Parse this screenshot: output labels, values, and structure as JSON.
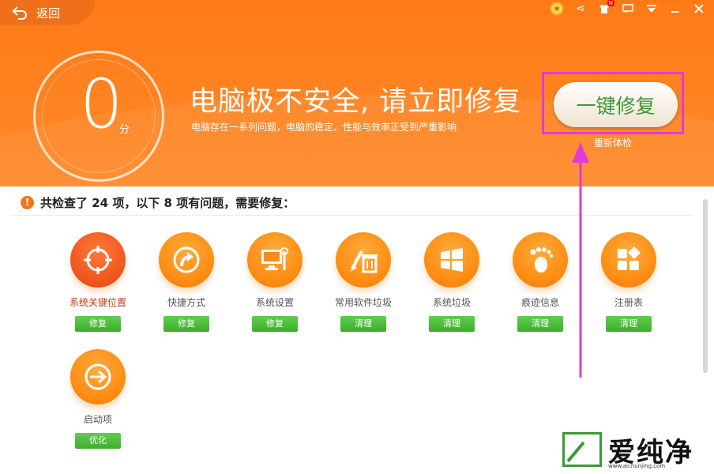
{
  "header": {
    "back_label": "返回",
    "score": "0",
    "score_unit": "分",
    "headline": "电脑极不安全, 请立即修复",
    "subline": "电脑存在一系列问题，电脑的稳定、性能与效率正受到严重影响",
    "fix_button": "一键修复",
    "recheck": "重新体检",
    "top_icons": [
      "medal-icon",
      "share-icon",
      "shirt-icon",
      "message-icon",
      "menu-icon",
      "minimize-icon",
      "close-icon"
    ],
    "badge": "N"
  },
  "panel": {
    "summary": "共检查了 24 项，以下 8 项有问题，需要修复：",
    "items": [
      {
        "label": "系统关键位置",
        "action": "修复",
        "icon": "target-icon"
      },
      {
        "label": "快捷方式",
        "action": "修复",
        "icon": "shortcut-arrow-icon"
      },
      {
        "label": "系统设置",
        "action": "修复",
        "icon": "monitor-wrench-icon"
      },
      {
        "label": "常用软件垃圾",
        "action": "清理",
        "icon": "brush-trash-icon"
      },
      {
        "label": "系统垃圾",
        "action": "清理",
        "icon": "windows-logo-icon"
      },
      {
        "label": "痕迹信息",
        "action": "清理",
        "icon": "footprint-icon"
      },
      {
        "label": "注册表",
        "action": "清理",
        "icon": "registry-blocks-icon"
      },
      {
        "label": "启动项",
        "action": "优化",
        "icon": "startup-arrow-icon"
      }
    ]
  },
  "watermark": {
    "text": "爱纯净",
    "url": "www.aichunjing.com"
  },
  "colors": {
    "header_orange": "#ff7a17",
    "button_green": "#3fae2c",
    "highlight_magenta": "#e23ad6"
  }
}
